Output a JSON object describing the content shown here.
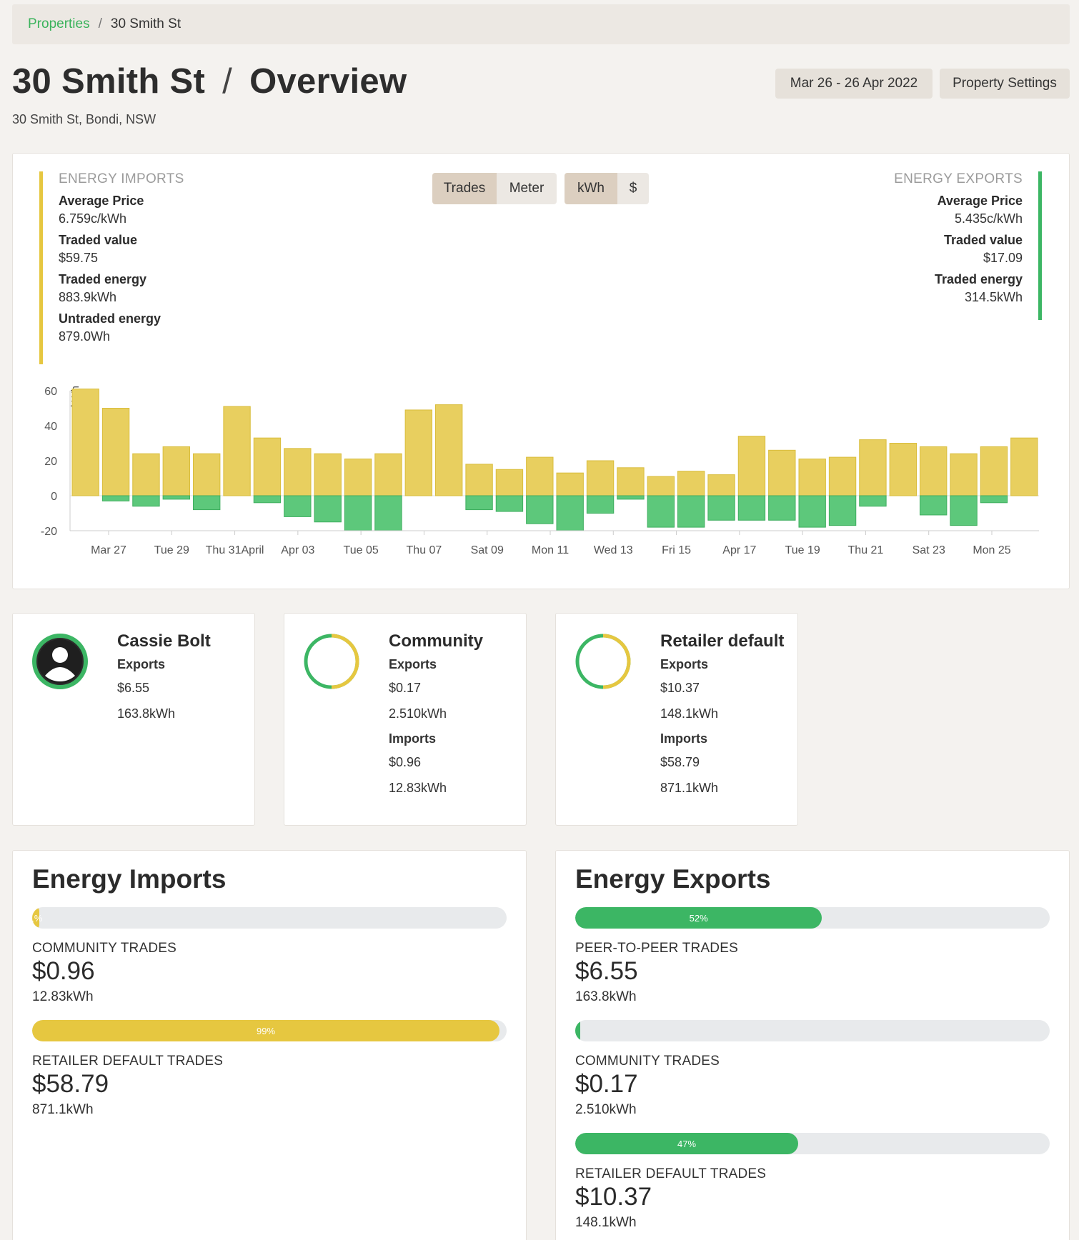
{
  "breadcrumb": {
    "parent": "Properties",
    "separator": "/",
    "current": "30 Smith St"
  },
  "header": {
    "property": "30 Smith St",
    "slash": "/",
    "view": "Overview",
    "address": "30 Smith St, Bondi, NSW",
    "date_range": "Mar 26 - 26 Apr 2022",
    "settings_label": "Property Settings"
  },
  "summary": {
    "imports": {
      "heading": "ENERGY IMPORTS",
      "avg_price_label": "Average Price",
      "avg_price": "6.759c/kWh",
      "traded_value_label": "Traded value",
      "traded_value": "$59.75",
      "traded_energy_label": "Traded energy",
      "traded_energy": "883.9kWh",
      "untraded_energy_label": "Untraded energy",
      "untraded_energy": "879.0Wh"
    },
    "exports": {
      "heading": "ENERGY EXPORTS",
      "avg_price_label": "Average Price",
      "avg_price": "5.435c/kWh",
      "traded_value_label": "Traded value",
      "traded_value": "$17.09",
      "traded_energy_label": "Traded energy",
      "traded_energy": "314.5kWh"
    }
  },
  "toggles": {
    "source": {
      "trades": "Trades",
      "meter": "Meter",
      "active": "Trades"
    },
    "unit": {
      "kwh": "kWh",
      "dollar": "$",
      "active": "kWh"
    }
  },
  "colors": {
    "import": "#e8cf5f",
    "import_stroke": "#d9bd3c",
    "export": "#5dc87b",
    "export_stroke": "#3fae5f",
    "accent": "#3bb35c",
    "yellow_bar": "#e6c740",
    "green_bar": "#3cb664"
  },
  "chart_data": {
    "type": "bar",
    "ylabel": "kWh",
    "ylim": [
      -20,
      60
    ],
    "yticks": [
      60,
      40,
      20,
      0,
      -20
    ],
    "xtick_labels": [
      "Mar 27",
      "Tue 29",
      "Thu 31April",
      "Apr 03",
      "Tue 05",
      "Thu 07",
      "Sat 09",
      "Mon 11",
      "Wed 13",
      "Fri 15",
      "Apr 17",
      "Tue 19",
      "Thu 21",
      "Sat 23",
      "Mon 25"
    ],
    "series": [
      {
        "values": [
          61,
          50,
          24,
          28,
          24,
          51,
          33,
          27,
          24,
          21,
          24,
          49,
          52,
          18,
          15,
          22,
          13,
          20,
          16,
          11,
          14,
          12,
          34,
          26,
          21,
          22,
          32,
          30,
          28,
          24,
          28,
          33
        ]
      },
      {
        "values": [
          0,
          -3,
          -6,
          -2,
          -8,
          0,
          -4,
          -12,
          -15,
          -20,
          -20,
          0,
          0,
          -8,
          -9,
          -16,
          -20,
          -10,
          -2,
          -18,
          -18,
          -14,
          -14,
          -14,
          -18,
          -17,
          -6,
          0,
          -11,
          -17,
          -4,
          0
        ]
      }
    ]
  },
  "parties": [
    {
      "name": "Cassie Bolt",
      "exports_label": "Exports",
      "exports_value": "$6.55",
      "exports_energy": "163.8kWh"
    },
    {
      "name": "Community",
      "exports_label": "Exports",
      "exports_value": "$0.17",
      "exports_energy": "2.510kWh",
      "imports_label": "Imports",
      "imports_value": "$0.96",
      "imports_energy": "12.83kWh"
    },
    {
      "name": "Retailer default",
      "exports_label": "Exports",
      "exports_value": "$10.37",
      "exports_energy": "148.1kWh",
      "imports_label": "Imports",
      "imports_value": "$58.79",
      "imports_energy": "871.1kWh"
    }
  ],
  "energy_imports": {
    "title": "Energy Imports",
    "items": [
      {
        "bar_label": "1%",
        "fraction": 0.015,
        "label": "COMMUNITY TRADES",
        "value": "$0.96",
        "energy": "12.83kWh"
      },
      {
        "bar_label": "99%",
        "fraction": 0.985,
        "label": "RETAILER DEFAULT TRADES",
        "value": "$58.79",
        "energy": "871.1kWh"
      }
    ]
  },
  "energy_exports": {
    "title": "Energy Exports",
    "items": [
      {
        "bar_label": "52%",
        "fraction": 0.52,
        "label": "PEER-TO-PEER TRADES",
        "value": "$6.55",
        "energy": "163.8kWh"
      },
      {
        "bar_label": "1%",
        "fraction": 0.01,
        "label": "COMMUNITY TRADES",
        "value": "$0.17",
        "energy": "2.510kWh"
      },
      {
        "bar_label": "47%",
        "fraction": 0.47,
        "label": "RETAILER DEFAULT TRADES",
        "value": "$10.37",
        "energy": "148.1kWh"
      }
    ]
  }
}
